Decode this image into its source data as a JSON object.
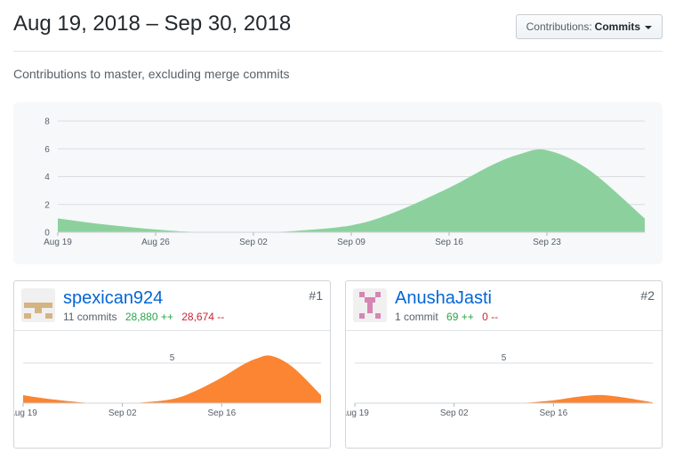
{
  "header": {
    "title": "Aug 19, 2018 – Sep 30, 2018",
    "contrib_label": "Contributions:",
    "contrib_value": "Commits"
  },
  "subtitle": "Contributions to master, excluding merge commits",
  "colors": {
    "main_fill": "#8cd19d",
    "contributor_fill": "#fb8532",
    "add": "#28a745",
    "del": "#cb2431",
    "link": "#0366d6"
  },
  "chart_data": [
    {
      "type": "area",
      "title": "",
      "x": [
        "Aug 19",
        "Aug 22",
        "Aug 26",
        "Aug 29",
        "Sep 02",
        "Sep 05",
        "Sep 09",
        "Sep 12",
        "Sep 16",
        "Sep 19",
        "Sep 21",
        "Sep 23",
        "Sep 26",
        "Sep 30"
      ],
      "x_ticks": [
        "Aug 19",
        "Aug 26",
        "Sep 02",
        "Sep 09",
        "Sep 16",
        "Sep 23"
      ],
      "series": [
        {
          "values": [
            1.0,
            0.6,
            0.2,
            0.02,
            0,
            0.1,
            0.5,
            1.4,
            3.2,
            4.8,
            5.6,
            5.9,
            4.5,
            1.0
          ]
        }
      ],
      "y_ticks": [
        0,
        2,
        4,
        6,
        8
      ],
      "ylim": [
        0,
        8
      ],
      "grid": true
    },
    {
      "type": "area",
      "contributor": "spexican924",
      "x": [
        "Aug 19",
        "Aug 22",
        "Aug 26",
        "Aug 29",
        "Sep 02",
        "Sep 05",
        "Sep 09",
        "Sep 12",
        "Sep 16",
        "Sep 19",
        "Sep 21",
        "Sep 23",
        "Sep 26",
        "Sep 30"
      ],
      "x_ticks": [
        "Aug 19",
        "Sep 02",
        "Sep 16"
      ],
      "series": [
        {
          "values": [
            1.0,
            0.6,
            0.2,
            0.02,
            0,
            0.1,
            0.5,
            1.4,
            3.2,
            4.8,
            5.6,
            5.9,
            4.5,
            1.0
          ]
        }
      ],
      "y_ticks": [
        5
      ],
      "ylim": [
        0,
        7
      ],
      "grid": true
    },
    {
      "type": "area",
      "contributor": "AnushaJasti",
      "x": [
        "Aug 19",
        "Aug 22",
        "Aug 26",
        "Aug 29",
        "Sep 02",
        "Sep 05",
        "Sep 09",
        "Sep 12",
        "Sep 16",
        "Sep 19",
        "Sep 21",
        "Sep 23",
        "Sep 26",
        "Sep 30"
      ],
      "x_ticks": [
        "Aug 19",
        "Sep 02",
        "Sep 16"
      ],
      "series": [
        {
          "values": [
            0,
            0,
            0,
            0,
            0,
            0,
            0,
            0.05,
            0.35,
            0.75,
            0.95,
            1.0,
            0.7,
            0.1
          ]
        }
      ],
      "y_ticks": [
        5
      ],
      "ylim": [
        0,
        7
      ],
      "grid": true
    }
  ],
  "contributors": [
    {
      "name": "spexican924",
      "commits": "11 commits",
      "additions": "28,880 ++",
      "deletions": "28,674 --",
      "rank": "#1",
      "avatar_color": "#d4b483"
    },
    {
      "name": "AnushaJasti",
      "commits": "1 commit",
      "additions": "69 ++",
      "deletions": "0 --",
      "rank": "#2",
      "avatar_color": "#d685b5"
    }
  ]
}
